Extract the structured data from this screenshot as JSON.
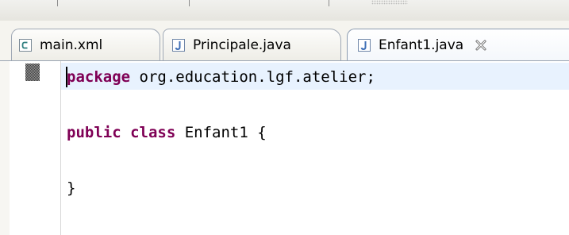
{
  "tabs": [
    {
      "label": "main.xml",
      "icon": "xml-file-icon",
      "active": false
    },
    {
      "label": "Principale.java",
      "icon": "java-file-icon",
      "active": false
    },
    {
      "label": "Enfant1.java",
      "icon": "java-file-icon",
      "active": true,
      "close_icon": "close-icon"
    }
  ],
  "editor": {
    "line1": {
      "keyword": "package",
      "rest": " org.education.lgf.atelier;"
    },
    "line2": {
      "keyword1": "public",
      "space": " ",
      "keyword2": "class",
      "rest": " Enfant1 {"
    },
    "line3": {
      "text": "}"
    }
  },
  "colors": {
    "keyword": "#7f0055",
    "current_line": "#e8f2fe",
    "java_icon": "#3f6fb6"
  }
}
